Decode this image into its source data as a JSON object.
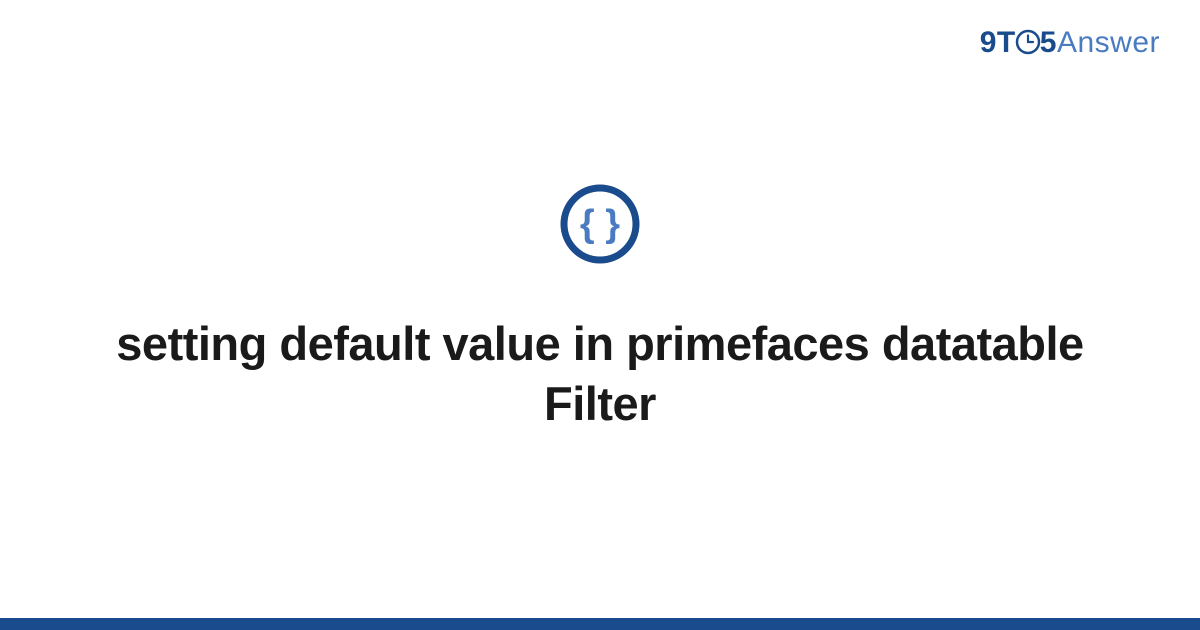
{
  "header": {
    "logo_prefix": "9T",
    "logo_digit": "5",
    "logo_suffix": "Answer"
  },
  "main": {
    "icon_name": "code-braces-icon",
    "title": "setting default value in primefaces datatable Filter"
  },
  "colors": {
    "primary_dark": "#1a4b8c",
    "primary_light": "#4a7bc0",
    "text": "#1a1a1a"
  }
}
